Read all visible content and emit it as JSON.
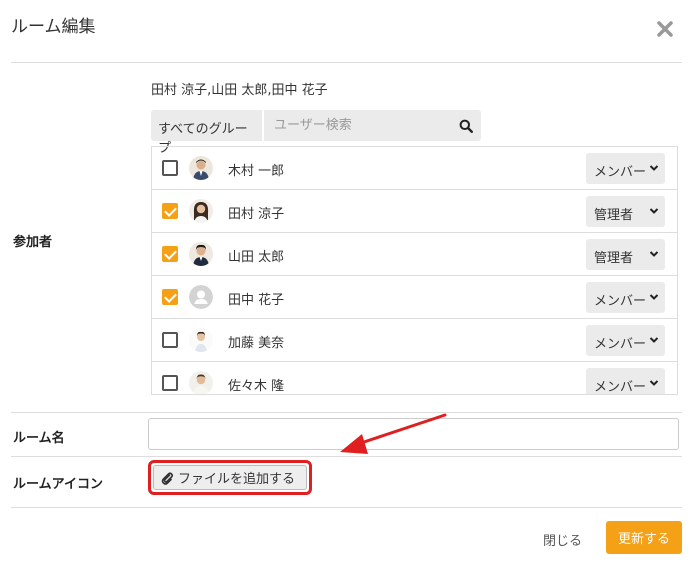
{
  "dialog": {
    "title": "ルーム編集"
  },
  "labels": {
    "participants": "参加者",
    "room_name": "ルーム名",
    "room_icon": "ルームアイコン"
  },
  "selected_names": "田村 涼子,山田 太郎,田中 花子",
  "filter": {
    "group": "すべてのグループ",
    "search_placeholder": "ユーザー検索"
  },
  "members": [
    {
      "name": "木村 一郎",
      "checked": false,
      "role": "メンバー",
      "avatar": "photo-avatar-1"
    },
    {
      "name": "田村 涼子",
      "checked": true,
      "role": "管理者",
      "avatar": "photo-avatar-2"
    },
    {
      "name": "山田 太郎",
      "checked": true,
      "role": "管理者",
      "avatar": "photo-avatar-3"
    },
    {
      "name": "田中 花子",
      "checked": true,
      "role": "メンバー",
      "avatar": "default-user-icon"
    },
    {
      "name": "加藤 美奈",
      "checked": false,
      "role": "メンバー",
      "avatar": "photo-avatar-5"
    },
    {
      "name": "佐々木 隆",
      "checked": false,
      "role": "メンバー",
      "avatar": "photo-avatar-6"
    }
  ],
  "room_name_value": "",
  "add_file_label": "ファイルを追加する",
  "footer": {
    "close_label": "閉じる",
    "update_label": "更新する"
  },
  "colors": {
    "accent": "#f5a118",
    "highlight": "#e02020"
  },
  "icons": [
    "close-icon",
    "search-icon",
    "chevron-down-icon",
    "paperclip-icon",
    "default-user-icon"
  ]
}
